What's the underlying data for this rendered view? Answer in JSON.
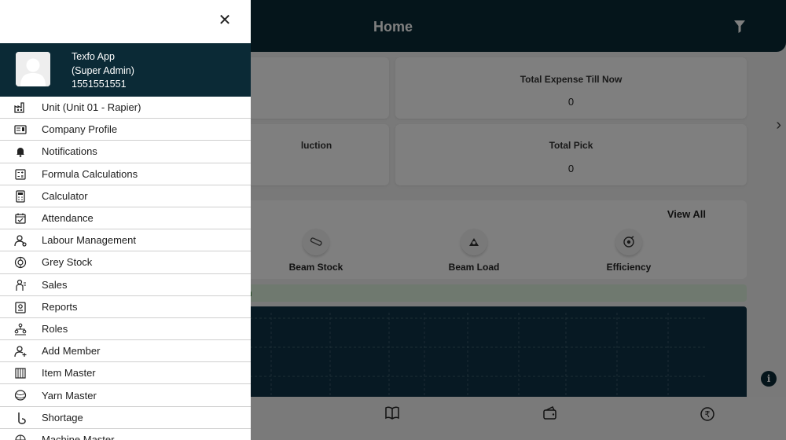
{
  "header": {
    "title": "Home"
  },
  "cards": [
    {
      "label": "",
      "value": ""
    },
    {
      "label": "Total Expense Till Now",
      "value": "0"
    },
    {
      "label": "luction",
      "value": ""
    },
    {
      "label": "Total Pick",
      "value": "0"
    }
  ],
  "quick_menu": {
    "view_all": "View All",
    "items": [
      {
        "label": "Beam Stock",
        "icon": "beam-stock-icon"
      },
      {
        "label": "Beam Load",
        "icon": "beam-load-icon"
      },
      {
        "label": "Efficiency",
        "icon": "efficiency-icon"
      }
    ]
  },
  "green_bar": {
    "text": "n"
  },
  "profile": {
    "name": "Texfo App",
    "role": "(Super Admin)",
    "phone": "1551551551"
  },
  "drawer": {
    "items": [
      {
        "label": "Unit (Unit 01 - Rapier)",
        "icon": "factory-icon"
      },
      {
        "label": "Company Profile",
        "icon": "id-card-icon"
      },
      {
        "label": "Notifications",
        "icon": "bell-icon"
      },
      {
        "label": "Formula Calculations",
        "icon": "formula-icon"
      },
      {
        "label": "Calculator",
        "icon": "calculator-icon"
      },
      {
        "label": "Attendance",
        "icon": "attendance-icon"
      },
      {
        "label": "Labour Management",
        "icon": "labour-icon"
      },
      {
        "label": "Grey Stock",
        "icon": "grey-stock-icon"
      },
      {
        "label": "Sales",
        "icon": "sales-icon"
      },
      {
        "label": "Reports",
        "icon": "reports-icon"
      },
      {
        "label": "Roles",
        "icon": "roles-icon"
      },
      {
        "label": "Add Member",
        "icon": "add-member-icon"
      },
      {
        "label": "Item Master",
        "icon": "item-master-icon"
      },
      {
        "label": "Yarn Master",
        "icon": "yarn-icon"
      },
      {
        "label": "Shortage",
        "icon": "shortage-icon"
      },
      {
        "label": "Machine Master",
        "icon": "machine-icon"
      }
    ]
  },
  "colors": {
    "primary": "#0b2a36",
    "text": "#1d1d1d",
    "divider": "#cfcfcf"
  }
}
